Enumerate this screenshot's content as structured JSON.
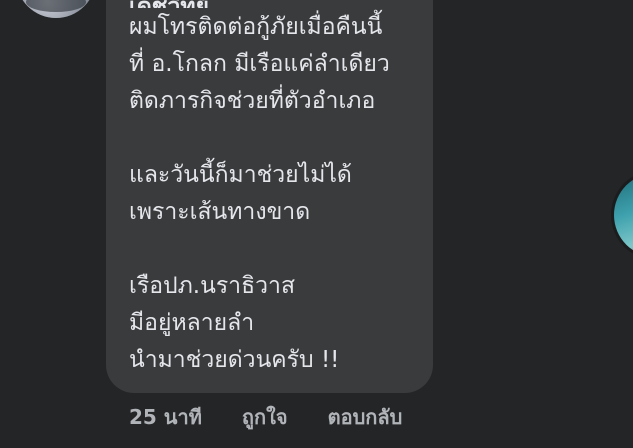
{
  "comment": {
    "author": "เดชวิทย์",
    "lines_block1": [
      "ผมโทรติดต่อกู้ภัยเมื่อคืนนี้",
      "ที่ อ.โกลก มีเรือแค่ลำเดียว",
      "ติดภารกิจช่วยที่ตัวอำเภอ"
    ],
    "lines_block2": [
      "และวันนี้ก็มาช่วยไม่ได้",
      "เพราะเส้นทางขาด"
    ],
    "lines_block3": [
      "เรือปภ.นราธิวาส",
      "มีอยู่หลายลำ",
      "นำมาช่วยด่วนครับ !!"
    ],
    "timestamp": "25 นาที",
    "like_label": "ถูกใจ",
    "reply_label": "ตอบกลับ"
  },
  "colors": {
    "background": "#242526",
    "bubble": "#3a3b3c",
    "text": "#e4e6eb",
    "secondary_text": "#b0b3b8"
  }
}
